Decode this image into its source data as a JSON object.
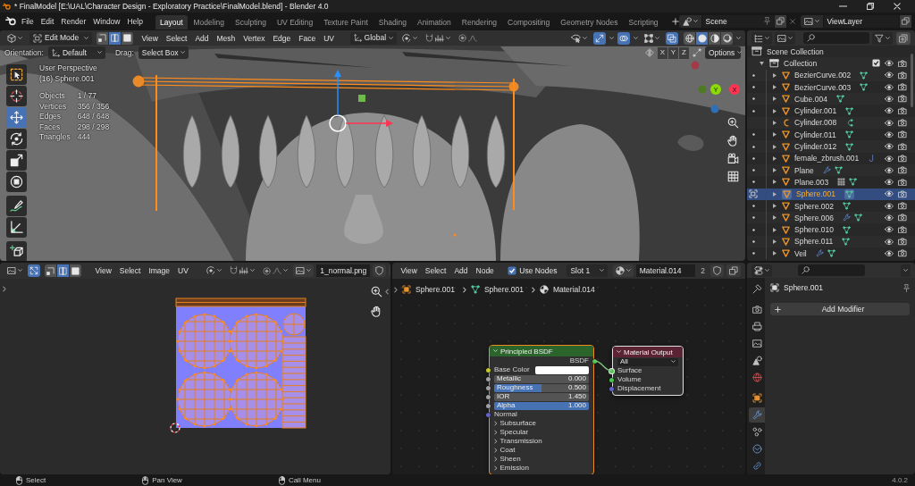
{
  "window": {
    "title": "* FinalModel [E:\\UAL\\Character Design - Exploratory Practice\\FinalModel.blend] - Blender 4.0"
  },
  "menu": [
    "File",
    "Edit",
    "Render",
    "Window",
    "Help"
  ],
  "workspaces": [
    {
      "label": "Layout",
      "selected": true
    },
    {
      "label": "Modeling",
      "selected": false
    },
    {
      "label": "Sculpting",
      "selected": false
    },
    {
      "label": "UV Editing",
      "selected": false
    },
    {
      "label": "Texture Paint",
      "selected": false
    },
    {
      "label": "Shading",
      "selected": false
    },
    {
      "label": "Animation",
      "selected": false
    },
    {
      "label": "Rendering",
      "selected": false
    },
    {
      "label": "Compositing",
      "selected": false
    },
    {
      "label": "Geometry Nodes",
      "selected": false
    },
    {
      "label": "Scripting",
      "selected": false
    }
  ],
  "scene": "Scene",
  "view_layer": "ViewLayer",
  "viewport": {
    "mode": "Edit Mode",
    "select_modes": [
      {
        "kind": "vertex",
        "selected": false
      },
      {
        "kind": "edge",
        "selected": true
      },
      {
        "kind": "face",
        "selected": false
      }
    ],
    "menus": [
      "View",
      "Select",
      "Add",
      "Mesh",
      "Vertex",
      "Edge",
      "Face",
      "UV"
    ],
    "orientation": "Global",
    "gizmos": true,
    "overlays": true,
    "xray": true,
    "shading": [
      {
        "kind": "wireframe",
        "selected": false
      },
      {
        "kind": "solid",
        "selected": true
      },
      {
        "kind": "material",
        "selected": false
      },
      {
        "kind": "rendered",
        "selected": false
      }
    ],
    "tool_settings": {
      "orientation_label": "Orientation:",
      "orientation": "Default",
      "drag_label": "Drag:",
      "drag": "Select Box",
      "axes": [
        "X",
        "Y",
        "Z"
      ],
      "options": "Options"
    },
    "tools": [
      {
        "kind": "select_box",
        "selected": false
      },
      {
        "kind": "cursor",
        "selected": false
      },
      {
        "kind": "move",
        "selected": true
      },
      {
        "kind": "rotate",
        "selected": false
      },
      {
        "kind": "scale",
        "selected": false
      },
      {
        "kind": "transform",
        "selected": false
      },
      {
        "kind": "annotate",
        "selected": false
      },
      {
        "kind": "measure",
        "selected": false
      },
      {
        "kind": "add_cube",
        "selected": false
      }
    ],
    "view_name": "User Perspective",
    "active_object": "(16) Sphere.001",
    "stats": [
      {
        "label": "Objects",
        "value": "1 / 77"
      },
      {
        "label": "Vertices",
        "value": "356 / 356"
      },
      {
        "label": "Edges",
        "value": "648 / 648"
      },
      {
        "label": "Faces",
        "value": "298 / 298"
      },
      {
        "label": "Triangles",
        "value": "444"
      }
    ],
    "gizmo_axes": [
      "Y",
      "X"
    ]
  },
  "outliner": {
    "root": "Scene Collection",
    "collection": {
      "name": "Collection",
      "checked": true
    },
    "objects": [
      {
        "name": "BezierCurve.002",
        "kind": "mesh",
        "editable": true,
        "in_edit_mode": false,
        "selected": false,
        "data": [
          {
            "kind": "mesh"
          }
        ]
      },
      {
        "name": "BezierCurve.003",
        "kind": "mesh",
        "editable": true,
        "in_edit_mode": false,
        "selected": false,
        "data": [
          {
            "kind": "mesh"
          }
        ]
      },
      {
        "name": "Cube.004",
        "kind": "mesh",
        "editable": true,
        "in_edit_mode": false,
        "selected": false,
        "data": [
          {
            "kind": "mesh"
          }
        ]
      },
      {
        "name": "Cylinder.001",
        "kind": "mesh",
        "editable": true,
        "in_edit_mode": false,
        "selected": false,
        "data": [
          {
            "kind": "mesh"
          }
        ]
      },
      {
        "name": "Cylinder.008",
        "kind": "curve",
        "editable": false,
        "in_edit_mode": false,
        "selected": false,
        "data": [
          {
            "kind": "curve"
          }
        ]
      },
      {
        "name": "Cylinder.011",
        "kind": "mesh",
        "editable": true,
        "in_edit_mode": false,
        "selected": false,
        "data": [
          {
            "kind": "mesh"
          }
        ]
      },
      {
        "name": "Cylinder.012",
        "kind": "mesh",
        "editable": true,
        "in_edit_mode": false,
        "selected": false,
        "data": [
          {
            "kind": "mesh"
          }
        ]
      },
      {
        "name": "female_zbrush.001",
        "kind": "mesh",
        "editable": true,
        "in_edit_mode": false,
        "selected": false,
        "data": [
          {
            "kind": "hair"
          }
        ]
      },
      {
        "name": "Plane",
        "kind": "mesh",
        "editable": true,
        "in_edit_mode": false,
        "selected": false,
        "data": [
          {
            "kind": "modifier"
          },
          {
            "kind": "mesh"
          }
        ]
      },
      {
        "name": "Plane.003",
        "kind": "mesh",
        "editable": true,
        "in_edit_mode": false,
        "selected": false,
        "data": [
          {
            "kind": "grid"
          },
          {
            "kind": "mesh"
          }
        ]
      },
      {
        "name": "Sphere.001",
        "kind": "mesh",
        "editable": true,
        "in_edit_mode": true,
        "selected": true,
        "data": [
          {
            "kind": "mesh"
          }
        ]
      },
      {
        "name": "Sphere.002",
        "kind": "mesh",
        "editable": true,
        "in_edit_mode": false,
        "selected": false,
        "data": [
          {
            "kind": "mesh"
          }
        ]
      },
      {
        "name": "Sphere.006",
        "kind": "mesh",
        "editable": true,
        "in_edit_mode": false,
        "selected": false,
        "data": [
          {
            "kind": "modifier"
          },
          {
            "kind": "mesh"
          }
        ]
      },
      {
        "name": "Sphere.010",
        "kind": "mesh",
        "editable": true,
        "in_edit_mode": false,
        "selected": false,
        "data": [
          {
            "kind": "mesh"
          }
        ]
      },
      {
        "name": "Sphere.011",
        "kind": "mesh",
        "editable": true,
        "in_edit_mode": false,
        "selected": false,
        "data": [
          {
            "kind": "mesh"
          }
        ]
      },
      {
        "name": "Veil",
        "kind": "mesh",
        "editable": true,
        "in_edit_mode": false,
        "selected": false,
        "data": [
          {
            "kind": "modifier"
          },
          {
            "kind": "mesh"
          }
        ]
      }
    ]
  },
  "uv_editor": {
    "sync": true,
    "select_modes": [
      {
        "kind": "vertex",
        "selected": false
      },
      {
        "kind": "edge",
        "selected": true
      },
      {
        "kind": "face",
        "selected": false
      }
    ],
    "menus": [
      "View",
      "Select",
      "Image",
      "UV"
    ],
    "image": "1_normal.png"
  },
  "node_editor": {
    "menus": [
      "View",
      "Select",
      "Add",
      "Node"
    ],
    "use_nodes": {
      "label": "Use Nodes",
      "checked": true
    },
    "slot": "Slot 1",
    "material": "Material.014",
    "users": "2",
    "path": [
      {
        "kind": "object",
        "label": "Sphere.001"
      },
      {
        "kind": "mesh",
        "label": "Sphere.001"
      },
      {
        "kind": "material",
        "label": "Material.014"
      }
    ],
    "nodes": [
      {
        "kind": "shader",
        "title": "Principled BSDF",
        "selected": true,
        "active": true,
        "outputs": [
          "BSDF"
        ],
        "inputs": [
          {
            "kind": "color",
            "label": "Base Color",
            "color": "#ffffff"
          },
          {
            "kind": "factor",
            "label": "Metallic",
            "value": "0.000"
          },
          {
            "kind": "factor",
            "label": "Roughness",
            "value": "0.500",
            "level": 0.5
          },
          {
            "kind": "number",
            "label": "IOR",
            "value": "1.450"
          },
          {
            "kind": "factor",
            "label": "Alpha",
            "value": "1.000",
            "level": 1
          },
          {
            "kind": "vector",
            "label": "Normal"
          },
          {
            "kind": "panel",
            "label": "Subsurface"
          },
          {
            "kind": "panel",
            "label": "Specular"
          },
          {
            "kind": "panel",
            "label": "Transmission"
          },
          {
            "kind": "panel",
            "label": "Coat"
          },
          {
            "kind": "panel",
            "label": "Sheen"
          },
          {
            "kind": "panel",
            "label": "Emission"
          }
        ]
      },
      {
        "kind": "output",
        "title": "Material Output",
        "selected": true,
        "active": false,
        "target": "All",
        "inputs": [
          {
            "kind": "shader",
            "label": "Surface",
            "linked": true
          },
          {
            "kind": "shader",
            "label": "Volume",
            "linked": false
          },
          {
            "kind": "vector",
            "label": "Displacement",
            "linked": false
          }
        ]
      }
    ]
  },
  "properties": {
    "tabs": [
      {
        "kind": "tool",
        "selected": false
      },
      {
        "kind": "render",
        "selected": false
      },
      {
        "kind": "output",
        "selected": false
      },
      {
        "kind": "view_layer",
        "selected": false
      },
      {
        "kind": "scene",
        "selected": false
      },
      {
        "kind": "world",
        "selected": false
      },
      {
        "kind": "object",
        "selected": false
      },
      {
        "kind": "modifier",
        "selected": true
      },
      {
        "kind": "particles",
        "selected": false
      },
      {
        "kind": "physics",
        "selected": false
      },
      {
        "kind": "constraints",
        "selected": false
      }
    ],
    "object": "Sphere.001",
    "add_modifier": "Add Modifier"
  },
  "status_bar": {
    "hints": [
      {
        "kind": "left_click",
        "label": "Select"
      },
      {
        "kind": "middle_click",
        "label": "Pan View"
      },
      {
        "kind": "right_click",
        "label": "Call Menu"
      }
    ],
    "version": "4.0.2"
  }
}
